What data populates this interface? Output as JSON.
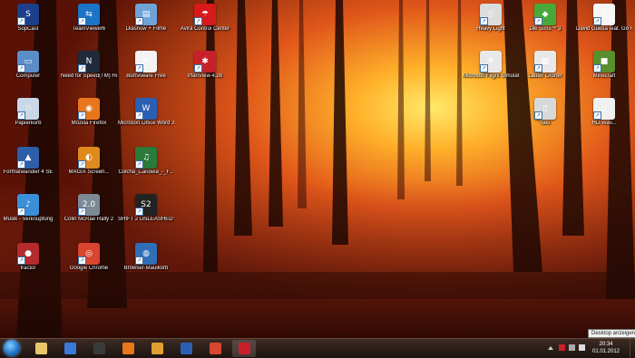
{
  "desktop": {
    "icons": [
      {
        "label": "SopCast",
        "color": "#1d3f8a",
        "glyph": "S"
      },
      {
        "label": "Computer",
        "color": "#5b8ec8",
        "glyph": "▭"
      },
      {
        "label": "Papierkorb",
        "color": "#c9d7e6",
        "glyph": "♲"
      },
      {
        "label": "Formatwandler 4 SE",
        "color": "#2d5fa8",
        "glyph": "▲"
      },
      {
        "label": "Musik - Verknüpfung",
        "color": "#3b8fd6",
        "glyph": "♪"
      },
      {
        "label": "fractor",
        "color": "#b52a2a",
        "glyph": "●"
      },
      {
        "label": "TeamViewer6",
        "color": "#1c74c8",
        "glyph": "⇆"
      },
      {
        "label": "Need for Speed(TM) Hot Pursuit",
        "color": "#1f2a3a",
        "glyph": "N"
      },
      {
        "label": "Mozilla Firefox",
        "color": "#e8761b",
        "glyph": "◉"
      },
      {
        "label": "MAGIX Screen...",
        "color": "#e08a1e",
        "glyph": "◐"
      },
      {
        "label": "Colin McRae Rally 2",
        "color": "#7d8a96",
        "glyph": "2.0"
      },
      {
        "label": "Google Chrome",
        "color": "#d9452f",
        "glyph": "◎"
      },
      {
        "label": "Diashow + Filme",
        "color": "#6fa3d8",
        "glyph": "▤"
      },
      {
        "label": "BurnAware Free",
        "color": "#f3f3f3",
        "glyph": "✎"
      },
      {
        "label": "Microsoft Office Word 2007",
        "color": "#2b5fb4",
        "glyph": "W"
      },
      {
        "label": "Culcha_Candela_-_F...",
        "color": "#2a7a3a",
        "glyph": "♫"
      },
      {
        "label": "SHIFT 2 UNLEASHED™ - Verknüpfung",
        "color": "#222",
        "glyph": "S2"
      },
      {
        "label": "Browser-Mauikorb",
        "color": "#2f6fb8",
        "glyph": "◍"
      },
      {
        "label": "Avira Control Center",
        "color": "#d7191c",
        "glyph": "☂"
      },
      {
        "label": "IrfanView 4.28",
        "color": "#c8202a",
        "glyph": "✱"
      },
      {
        "label": "Heavy Light",
        "color": "#dcdcdc",
        "glyph": "▯"
      },
      {
        "label": "Microsoft Flight Simulator X - ...",
        "color": "#e8e8e8",
        "glyph": "✈"
      },
      {
        "label": "Die Sims™ 3",
        "color": "#4aa83a",
        "glyph": "◆"
      },
      {
        "label": "Lauter Ordner",
        "color": "#e8e8e8",
        "glyph": "▦"
      },
      {
        "label": "David Guetta feat. Go Rida - Where Them...",
        "color": "#f6f6f6",
        "glyph": "♪"
      },
      {
        "label": "Minecraft",
        "color": "#5a8f2d",
        "glyph": "■"
      },
      {
        "label": "Neu",
        "color": "#d8d8d8",
        "glyph": "▯"
      },
      {
        "label": "HD-Wav...",
        "color": "#f0f0f0",
        "glyph": "▯"
      }
    ]
  },
  "taskbar": {
    "pinned": [
      {
        "name": "explorer",
        "color": "#e8c76a"
      },
      {
        "name": "media-player",
        "color": "#3a7ad8"
      },
      {
        "name": "headset",
        "color": "#3a3a3a"
      },
      {
        "name": "firefox",
        "color": "#e8761b"
      },
      {
        "name": "media-center",
        "color": "#e0a030"
      },
      {
        "name": "word",
        "color": "#2b5fb4"
      },
      {
        "name": "chrome",
        "color": "#d9452f"
      },
      {
        "name": "irfanview",
        "color": "#c8202a"
      }
    ],
    "clock": {
      "time": "20:34",
      "date": "01.01.2012"
    },
    "tooltip": "Desktop anzeigen"
  }
}
